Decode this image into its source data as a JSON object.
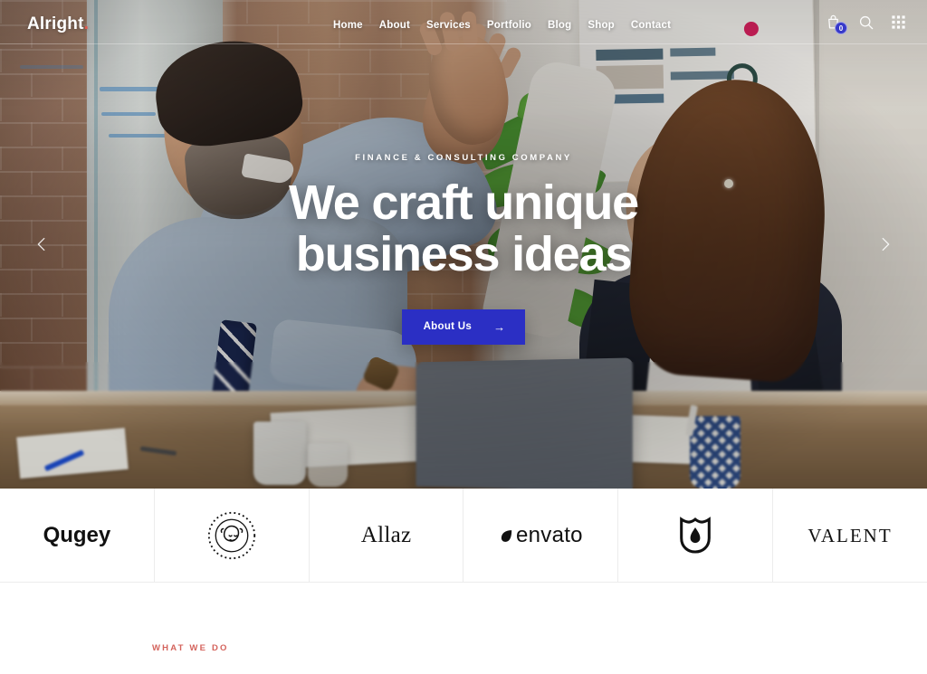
{
  "site": {
    "logo_text": "Alright",
    "logo_dot": "."
  },
  "header": {
    "nav": [
      {
        "label": "Home",
        "name": "nav-item-home",
        "active": true
      },
      {
        "label": "About",
        "name": "nav-item-about",
        "active": false
      },
      {
        "label": "Services",
        "name": "nav-item-services",
        "active": false
      },
      {
        "label": "Portfolio",
        "name": "nav-item-portfolio",
        "active": false
      },
      {
        "label": "Blog",
        "name": "nav-item-blog",
        "active": false
      },
      {
        "label": "Shop",
        "name": "nav-item-shop",
        "active": false
      },
      {
        "label": "Contact",
        "name": "nav-item-contact",
        "active": false
      }
    ],
    "icons": {
      "cart": "cart-icon",
      "cart_count": "0",
      "search": "search-icon",
      "grid": "grid-menu-icon"
    }
  },
  "hero": {
    "eyebrow": "FINANCE & CONSULTING COMPANY",
    "headline_line1": "We craft unique",
    "headline_line2": "business ideas",
    "cta_label": "About Us",
    "cta_arrow": "→",
    "prev_label": "Previous slide",
    "next_label": "Next slide"
  },
  "clients": [
    {
      "name": "client-logo-qugey",
      "text": "Qugey",
      "type": "text"
    },
    {
      "name": "client-logo-bulldog",
      "text": "",
      "type": "badge"
    },
    {
      "name": "client-logo-allaz",
      "text": "Allaz",
      "type": "text"
    },
    {
      "name": "client-logo-envato",
      "text": "envato",
      "type": "envato"
    },
    {
      "name": "client-logo-shield",
      "text": "",
      "type": "shield"
    },
    {
      "name": "client-logo-valent",
      "text": "VALENT",
      "type": "text"
    }
  ],
  "section": {
    "what_we_do": "WHAT WE DO"
  },
  "colors": {
    "accent_blue": "#2b2fc4",
    "accent_red": "#d4635c",
    "badge_blue": "#2f31c9",
    "logo_dot": "#e2574c",
    "text_dark": "#111111"
  }
}
